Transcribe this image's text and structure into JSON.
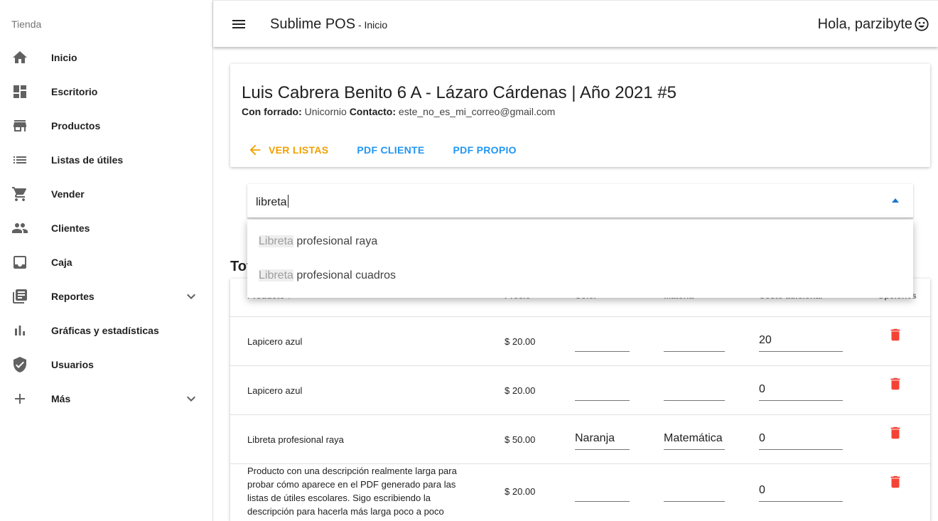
{
  "sidebar": {
    "title": "Tienda",
    "items": [
      {
        "label": "Inicio",
        "icon": "home-icon"
      },
      {
        "label": "Escritorio",
        "icon": "dashboard-icon"
      },
      {
        "label": "Productos",
        "icon": "store-icon"
      },
      {
        "label": "Listas de útiles",
        "icon": "list-icon"
      },
      {
        "label": "Vender",
        "icon": "cart-icon"
      },
      {
        "label": "Clientes",
        "icon": "people-icon"
      },
      {
        "label": "Caja",
        "icon": "inbox-icon"
      },
      {
        "label": "Reportes",
        "icon": "library-icon"
      },
      {
        "label": "Gráficas y estadísticas",
        "icon": "bar-chart-icon"
      },
      {
        "label": "Usuarios",
        "icon": "shield-check-icon"
      },
      {
        "label": "Más",
        "icon": "plus-icon"
      }
    ]
  },
  "topbar": {
    "title": "Sublime POS",
    "subtitle": " - Inicio",
    "greeting": "Hola, parzibyte",
    "greeting_icon": "smile-icon"
  },
  "header": {
    "title": "Luis Cabrera Benito 6 A - Lázaro Cárdenas | Año 2021 #5",
    "forrado_label": "Con forrado:",
    "forrado_value": "Unicornio",
    "contacto_label": "Contacto:",
    "contacto_value": "este_no_es_mi_correo@gmail.com",
    "actions": {
      "back": "Ver listas",
      "pdf_cliente": "PDF cliente",
      "pdf_propio": "PDF propio"
    }
  },
  "search": {
    "value": "libreta",
    "suggestions": [
      {
        "match": "Libreta",
        "rest": " profesional raya"
      },
      {
        "match": "Libreta",
        "rest": " profesional cuadros"
      }
    ]
  },
  "section_heading": "Total",
  "table": {
    "headers": {
      "producto": "Producto ↑",
      "precio": "Precio",
      "color": "Color",
      "materia": "Materia",
      "costo": "Costo adicional",
      "opciones": "Opciones"
    },
    "rows": [
      {
        "producto": "Lapicero azul",
        "precio": "$ 20.00",
        "color": "",
        "materia": "",
        "costo": "20"
      },
      {
        "producto": "Lapicero azul",
        "precio": "$ 20.00",
        "color": "",
        "materia": "",
        "costo": "0"
      },
      {
        "producto": "Libreta profesional raya",
        "precio": "$ 50.00",
        "color": "Naranja",
        "materia": "Matemática",
        "costo": "0"
      },
      {
        "producto": "Producto con una descripción realmente larga para probar cómo aparece en el PDF generado para las listas de útiles escolares. Sigo escribiendo la descripción para hacerla más larga poco a poco",
        "precio": "$ 20.00",
        "color": "",
        "materia": "",
        "costo": "0"
      }
    ]
  },
  "colors": {
    "accent_orange": "#f0a000",
    "accent_blue": "#2196f3",
    "delete_red": "#f44336"
  }
}
